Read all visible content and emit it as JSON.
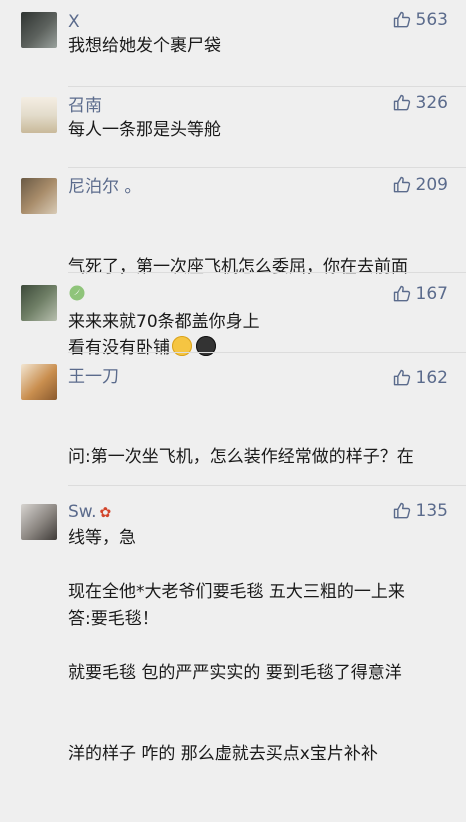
{
  "comments": [
    {
      "name": "X",
      "body": "我想给她发个裹尸袋",
      "likes": "563"
    },
    {
      "name": "召南",
      "body": "每人一条那是头等舱",
      "likes": "326"
    },
    {
      "name": "尼泊尔 。",
      "body_lines": [
        "气死了，第一次座飞机怎么委屈，你在去前面",
        "看有没有卧铺"
      ],
      "likes": "209",
      "emoji": [
        "hug-emoji",
        "dark-face-emoji"
      ]
    },
    {
      "name": "",
      "body": "来来来就70条都盖你身上",
      "likes": "167"
    },
    {
      "name": "王一刀",
      "body_lines": [
        "问:第一次坐飞机，怎么装作经常做的样子？在",
        "线等，急",
        "答:要毛毯！"
      ],
      "likes": "162"
    },
    {
      "name": "Sw.",
      "body_lines": [
        "现在全他*大老爷们要毛毯 五大三粗的一上来",
        "就要毛毯 包的严严实实的 要到毛毯了得意洋",
        "洋的样子 咋的 那么虚就去买点x宝片补补"
      ],
      "likes": "135"
    }
  ],
  "icons": {
    "like": "thumbs-up-icon",
    "name_badge": "paw-icon"
  },
  "colors": {
    "name": "#5b6b8c",
    "background": "#efefef"
  }
}
